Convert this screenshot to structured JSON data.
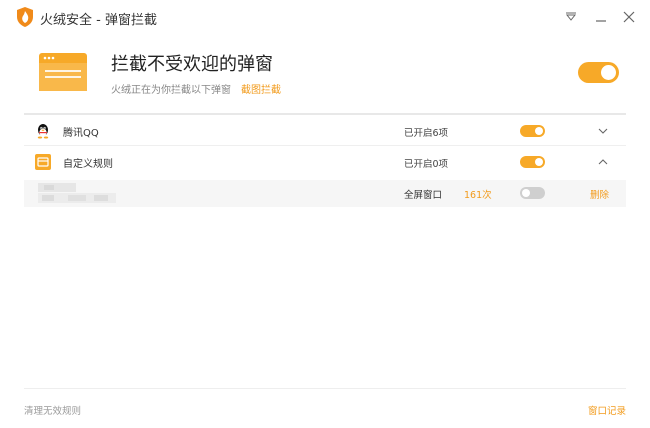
{
  "window": {
    "title": "火绒安全 - 弹窗拦截",
    "logo_icon": "huorong-shield-icon",
    "menu_icon": "menu-triangle-icon",
    "minimize_icon": "minimize-icon",
    "close_icon": "close-icon"
  },
  "header": {
    "title": "拦截不受欢迎的弹窗",
    "description": "火绒正在为你拦截以下弹窗",
    "link": "截图拦截",
    "master_toggle_on": true
  },
  "rules": [
    {
      "label": "腾讯QQ",
      "icon": "qq-penguin-icon",
      "status": "已开启6项",
      "toggle_on": true,
      "expanded": false
    },
    {
      "label": "自定义规则",
      "icon": "custom-rule-window-icon",
      "status": "已开启0项",
      "toggle_on": true,
      "expanded": true,
      "items": [
        {
          "window_type": "全屏窗口",
          "count": "161次",
          "toggle_on": false,
          "delete_label": "删除"
        }
      ]
    }
  ],
  "footer": {
    "clear_label": "清理无效规则",
    "log_label": "窗口记录"
  },
  "colors": {
    "accent": "#f7a928",
    "accent_text": "#f29b1c"
  }
}
